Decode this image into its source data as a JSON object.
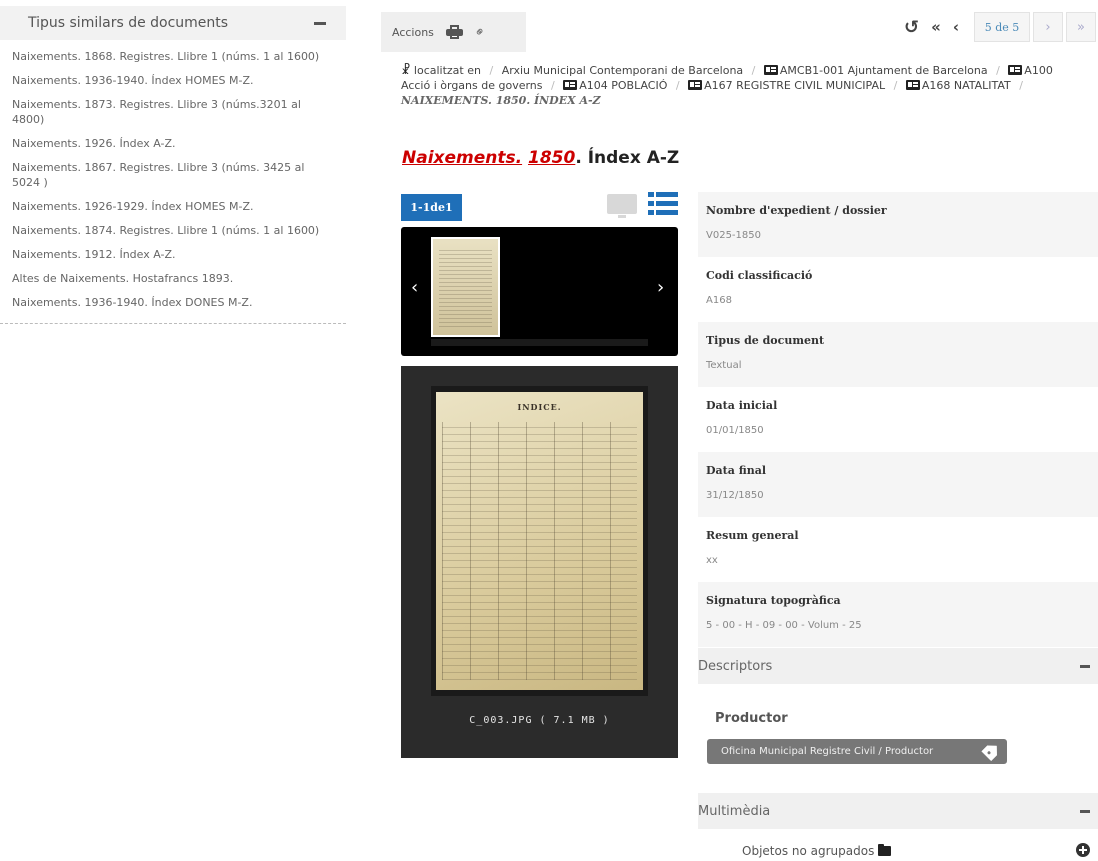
{
  "sidebar": {
    "title": "Tipus similars de documents",
    "items": [
      "Naixements. 1868. Registres. Llibre 1 (núms. 1 al 1600)",
      "Naixements. 1936-1940. Índex HOMES M-Z.",
      "Naixements. 1873. Registres. Llibre 3 (núms.3201 al 4800)",
      "Naixements. 1926. Índex A-Z.",
      "Naixements. 1867. Registres. Llibre 3 (núms. 3425 al 5024 )",
      "Naixements. 1926-1929. Índex HOMES M-Z.",
      "Naixements. 1874. Registres. Llibre 1 (núms. 1 al 1600)",
      "Naixements. 1912. Índex A-Z.",
      "Altes de Naixements. Hostafrancs 1893.",
      "Naixements. 1936-1940. Índex DONES M-Z."
    ]
  },
  "actions": {
    "label": "Accions",
    "print_icon": "printer-icon",
    "link_icon": "link-icon"
  },
  "pager": {
    "reset_icon": "rotate-ccw-icon",
    "first": "«",
    "prev": "‹",
    "position": "5 de 5",
    "next": "›",
    "last": "»"
  },
  "breadcrumb": {
    "located_in": "localitzat en",
    "items": [
      "Arxiu Municipal Contemporani de Barcelona",
      "AMCB1-001 Ajuntament de Barcelona",
      "A100 Acció i òrgans de governs",
      "A104 POBLACIÓ",
      "A167 REGISTRE CIVIL MUNICIPAL",
      "A168 NATALITAT"
    ],
    "current_part1": "NAIXEMENTS.",
    "current_year": "1850",
    "current_part2": ". ÍNDEX A-Z"
  },
  "title": {
    "part1": "Naixements.",
    "year": "1850",
    "rest": ". Índex A-Z"
  },
  "gallery": {
    "counter": "1-1de1",
    "thumb_prev": "‹",
    "thumb_next": "›",
    "page_heading": "INDICE.",
    "file_label": "C_003.JPG ( 7.1 MB )"
  },
  "metadata": [
    {
      "key": "Nombre d'expedient / dossier",
      "value": "V025-1850"
    },
    {
      "key": "Codi classificació",
      "value": "A168"
    },
    {
      "key": "Tipus de document",
      "value": "Textual"
    },
    {
      "key": "Data inicial",
      "value": "01/01/1850"
    },
    {
      "key": "Data final",
      "value": "31/12/1850"
    },
    {
      "key": "Resum general",
      "value": "xx"
    },
    {
      "key": "Signatura topogràfica",
      "value": "5 - 00 - H - 09 - 00 - Volum - 25"
    }
  ],
  "descriptors": {
    "title": "Descriptors",
    "productor_label": "Productor",
    "productor_tag": "Oficina Municipal Registre Civil / Productor"
  },
  "multimedia": {
    "title": "Multimèdia",
    "objects_label": "Objetos no agrupados"
  },
  "colors": {
    "accent": "#1f6fb8",
    "highlight": "#cc0000"
  }
}
